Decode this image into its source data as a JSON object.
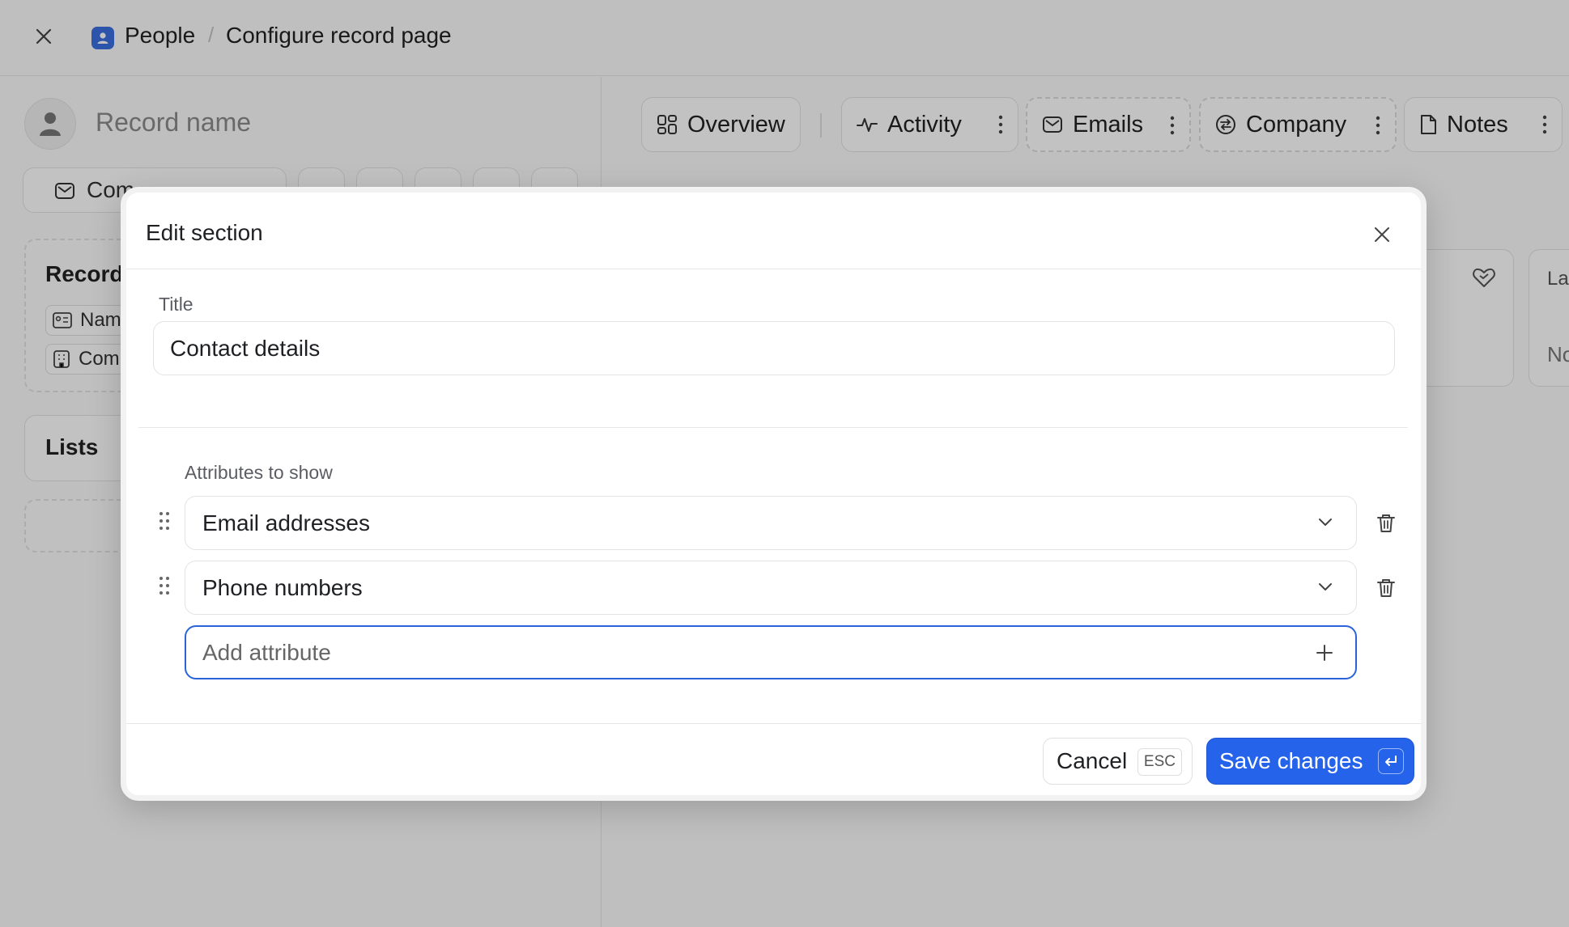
{
  "topbar": {
    "object_name": "People",
    "separator": "/",
    "page_title": "Configure record page"
  },
  "record": {
    "name_placeholder": "Record name",
    "compose_label": "Com"
  },
  "left_sections": {
    "record_heading": "Record",
    "chips": [
      "Nam",
      "Com"
    ],
    "lists_heading": "Lists"
  },
  "tabs": [
    {
      "label": "Overview",
      "icon": "overview-grid-icon"
    },
    {
      "label": "Activity",
      "icon": "activity-pulse-icon"
    },
    {
      "label": "Emails",
      "icon": "mail-icon"
    },
    {
      "label": "Company",
      "icon": "company-arrows-icon"
    },
    {
      "label": "Notes",
      "icon": "note-icon"
    }
  ],
  "right_partial": {
    "card_label": "La",
    "card_value": "No"
  },
  "modal": {
    "title": "Edit section",
    "title_label": "Title",
    "title_value": "Contact details",
    "attributes_label": "Attributes to show",
    "attributes": [
      {
        "label": "Email addresses"
      },
      {
        "label": "Phone numbers"
      }
    ],
    "add_attribute_placeholder": "Add attribute",
    "cancel_label": "Cancel",
    "cancel_shortcut": "ESC",
    "save_label": "Save changes"
  },
  "colors": {
    "accent": "#2563eb",
    "people_icon": "#3b6fe0"
  }
}
